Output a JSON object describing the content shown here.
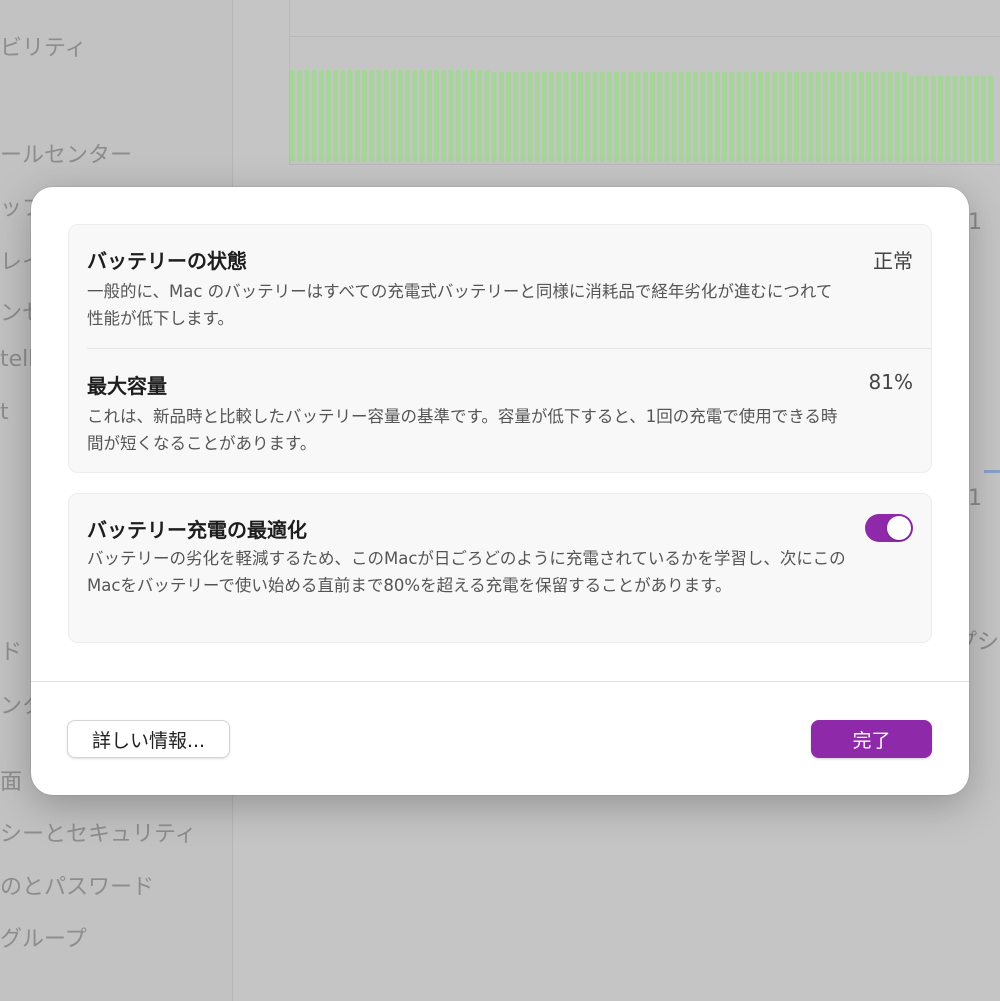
{
  "background": {
    "sidebar_items": [
      "ビリティ",
      "ールセンター",
      "ップ",
      "レイ",
      "ンセ",
      "tell",
      "t",
      "ド",
      "ンタ",
      "面",
      "シーとセキュリティ",
      "のとパスワード",
      "グループ"
    ],
    "chart_fragments": [
      "1",
      "1",
      "プシ"
    ]
  },
  "dialog": {
    "battery_condition": {
      "title": "バッテリーの状態",
      "description": "一般的に、Mac のバッテリーはすべての充電式バッテリーと同様に消耗品で経年劣化が進むにつれて性能が低下します。",
      "value": "正常"
    },
    "max_capacity": {
      "title": "最大容量",
      "description": "これは、新品時と比較したバッテリー容量の基準です。容量が低下すると、1回の充電で使用できる時間が短くなることがあります。",
      "value": "81%"
    },
    "optimized_charging": {
      "title": "バッテリー充電の最適化",
      "description": "バッテリーの劣化を軽減するため、このMacが日ごろどのように充電されているかを学習し、次にこのMacをバッテリーで使い始める直前まで80%を超える充電を保留することがあります。",
      "enabled": true
    },
    "buttons": {
      "more_info": "詳しい情報...",
      "done": "完了"
    }
  },
  "colors": {
    "accent": "#8e2aa9",
    "chart_bar": "#a6d59a"
  }
}
